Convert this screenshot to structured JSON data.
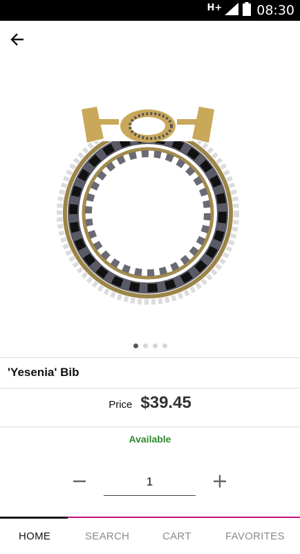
{
  "status_bar": {
    "network": "H+",
    "time": "08:30"
  },
  "icons": {
    "back": "back-arrow-icon",
    "signal": "signal-icon",
    "battery": "battery-icon",
    "minus": "minus-icon",
    "plus": "plus-icon"
  },
  "product": {
    "image": "necklace-image",
    "name": "'Yesenia' Bib",
    "price_label": "Price",
    "price": "$39.45",
    "availability": "Available",
    "image_count": 4,
    "active_image": 1
  },
  "quantity": {
    "value": "1"
  },
  "tabs": [
    {
      "label": "HOME",
      "active": true
    },
    {
      "label": "SEARCH",
      "active": false
    },
    {
      "label": "CART",
      "active": false
    },
    {
      "label": "FAVORITES",
      "active": false
    }
  ],
  "colors": {
    "accent": "#c2127a",
    "available_green": "#2f8a2f",
    "status_bar": "#000000"
  }
}
